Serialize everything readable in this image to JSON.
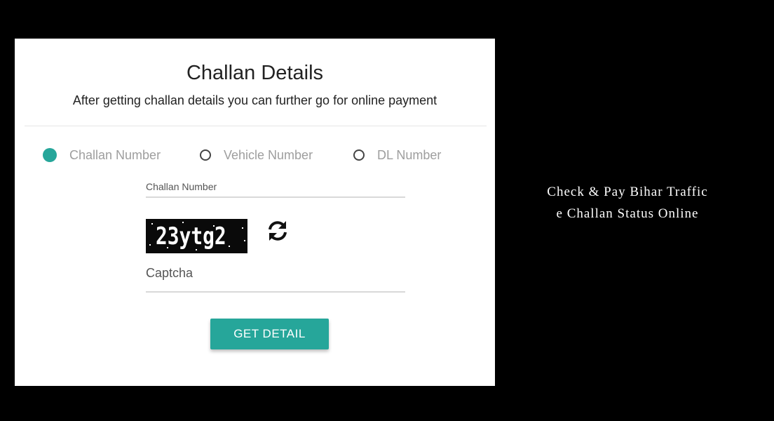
{
  "form": {
    "title": "Challan Details",
    "subtitle": "After getting challan details you can further go for online payment",
    "radio_options": [
      {
        "label": "Challan Number",
        "selected": true
      },
      {
        "label": "Vehicle Number",
        "selected": false
      },
      {
        "label": "DL Number",
        "selected": false
      }
    ],
    "challan_field_label": "Challan Number",
    "captcha_text": "23ytg2",
    "captcha_placeholder": "Captcha",
    "submit_label": "GET DETAIL",
    "refresh_icon": "refresh-icon",
    "accent_color": "#26a69a"
  },
  "caption": {
    "line1": "Check & Pay Bihar Traffic",
    "line2": "e Challan Status Online"
  }
}
